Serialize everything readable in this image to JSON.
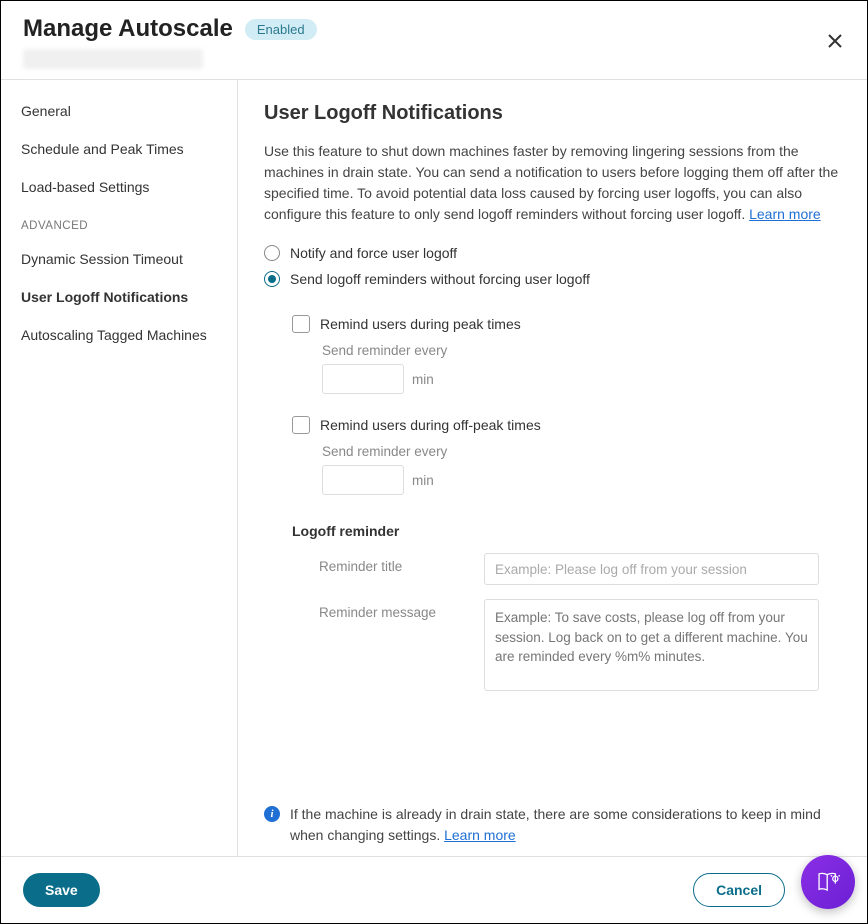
{
  "header": {
    "title": "Manage Autoscale",
    "badge": "Enabled"
  },
  "sidebar": {
    "items": [
      "General",
      "Schedule and Peak Times",
      "Load-based Settings"
    ],
    "advanced_label": "ADVANCED",
    "advanced_items": [
      "Dynamic Session Timeout",
      "User Logoff Notifications",
      "Autoscaling Tagged Machines"
    ],
    "active": "User Logoff Notifications"
  },
  "main": {
    "title": "User Logoff Notifications",
    "description": "Use this feature to shut down machines faster by removing lingering sessions from the machines in drain state. You can send a notification to users before logging them off after the specified time. To avoid potential data loss caused by forcing user logoffs, you can also configure this feature to only send logoff reminders without forcing user logoff. ",
    "learn_more": "Learn more",
    "radio": {
      "opt1": "Notify and force user logoff",
      "opt2": "Send logoff reminders without forcing user logoff"
    },
    "peak": {
      "label": "Remind users during peak times",
      "send_label": "Send reminder every",
      "unit": "min"
    },
    "offpeak": {
      "label": "Remind users during off-peak times",
      "send_label": "Send reminder every",
      "unit": "min"
    },
    "reminder_section": "Logoff reminder",
    "reminder_title_label": "Reminder title",
    "reminder_title_placeholder": "Example: Please log off from your session",
    "reminder_msg_label": "Reminder message",
    "reminder_msg_placeholder": "Example: To save costs, please log off from your session. Log back on to get a different machine. You are reminded every %m% minutes.",
    "info_text": "If the machine is already in drain state, there are some considerations to keep in mind when changing settings. ",
    "info_learn_more": "Learn more"
  },
  "footer": {
    "save": "Save",
    "cancel": "Cancel"
  }
}
